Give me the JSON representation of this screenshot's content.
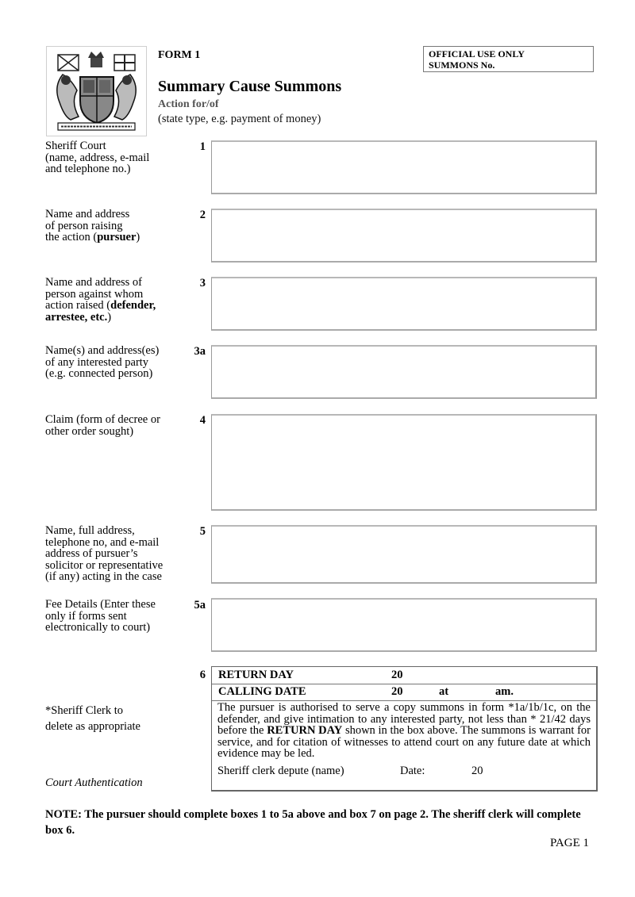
{
  "header": {
    "crest_icon": "royal-coat-of-arms-icon",
    "form_number": "FORM 1",
    "title": "Summary Cause Summons",
    "action_label": "Action for/of",
    "action_hint": "(state type, e.g. payment of money)",
    "official_use": {
      "line1": "OFFICIAL USE ONLY",
      "line2": "SUMMONS No."
    }
  },
  "fields": [
    {
      "number": "1",
      "label_lines": [
        "Sheriff Court",
        "(name, address, e-mail",
        "and telephone no.)"
      ],
      "value": ""
    },
    {
      "number": "2",
      "label_lines": [
        "Name and address",
        "of person raising",
        "the action (",
        "pursuer",
        ")"
      ],
      "value": ""
    },
    {
      "number": "3",
      "label_lines": [
        "Name and address of",
        "person against whom",
        "action raised (",
        "defender,",
        "arrestee, etc.",
        ")"
      ],
      "value": ""
    },
    {
      "number": "3a",
      "label_lines": [
        "Name(s) and address(es)",
        "of any interested party",
        "(e.g. connected person)"
      ],
      "value": ""
    },
    {
      "number": "4",
      "label_lines": [
        "Claim (form of decree or",
        "other order sought)"
      ],
      "value": ""
    },
    {
      "number": "5",
      "label_lines": [
        "Name, full address,",
        "telephone no, and e-mail",
        "address of pursuer’s",
        "solicitor or representative",
        "(if any) acting in the case"
      ],
      "value": ""
    },
    {
      "number": "5a",
      "label_lines": [
        "Fee Details (Enter these",
        "only if forms sent",
        "electronically to court)"
      ],
      "value": ""
    }
  ],
  "box6": {
    "number": "6",
    "return_day_label": "RETURN DAY",
    "return_day_year": "20",
    "calling_date_label": "CALLING DATE",
    "calling_date_year": "20",
    "calling_at": "at",
    "calling_am": "am.",
    "authorisation_pre": "The pursuer is authorised to serve a copy summons in form *1a/1b/1c, on the defender, and give intimation to any interested party, not less than * 21/42 days before the ",
    "authorisation_bold": "RETURN DAY",
    "authorisation_post": " shown in the box above.  The summons is warrant for service, and for citation of witnesses to attend court on any future date at which evidence may be led.",
    "sheriff_clerk_label": "Sheriff clerk depute (name)",
    "date_label": "Date:",
    "date_year": "20"
  },
  "side_notes": {
    "sheriff_clerk_line1": "*Sheriff Clerk to",
    "sheriff_clerk_line2": "delete as appropriate",
    "court_authentication": "Court Authentication"
  },
  "footer": {
    "note": "NOTE: The pursuer should complete boxes 1 to 5a above and box 7 on page 2. The sheriff clerk will complete box 6.",
    "page_label": "PAGE 1"
  }
}
